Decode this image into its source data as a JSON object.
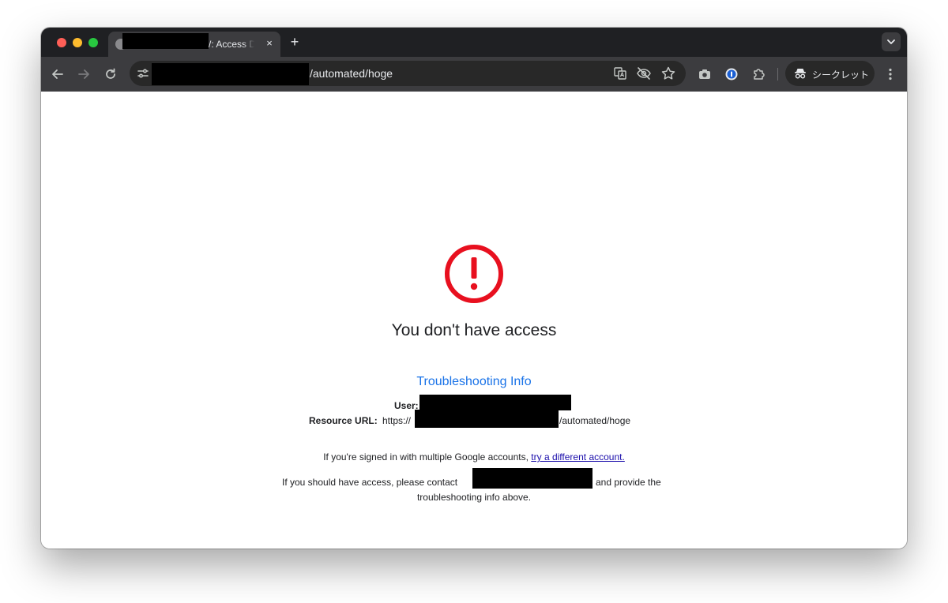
{
  "browser": {
    "tab": {
      "title": "/: Access D",
      "close_glyph": "×",
      "favicon": "globe-icon"
    },
    "new_tab_glyph": "+",
    "tab_search_glyph": "⌄",
    "address_bar": {
      "url_suffix": "/automated/hoge"
    },
    "incognito": {
      "label": "シークレット"
    },
    "icons": [
      "back-icon",
      "forward-icon",
      "reload-icon",
      "site-settings-icon",
      "translate-icon",
      "eye-off-icon",
      "star-icon",
      "camera-icon",
      "password-manager-icon",
      "extensions-icon",
      "incognito-icon",
      "menu-icon"
    ]
  },
  "page": {
    "alert_color": "#e8101f",
    "heading": "You don't have access",
    "troubleshooting": {
      "title": "Troubleshooting Info",
      "user_label": "User:",
      "resource_label": "Resource URL:",
      "resource_prefix": "https://",
      "resource_suffix": "/automated/hoge"
    },
    "multiple_accounts": {
      "text": "If you're signed in with multiple Google accounts,",
      "link": "try a different account."
    },
    "contact": {
      "prefix": "If you should have access, please contact",
      "suffix": "and provide the",
      "line2": "troubleshooting info above."
    }
  },
  "colors": {
    "link_blue": "#1a73e8",
    "alert_red": "#e8101f"
  }
}
